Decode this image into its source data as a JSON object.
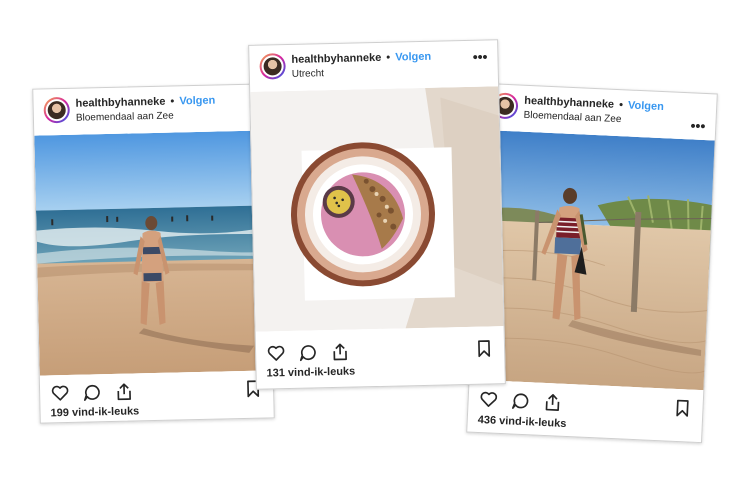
{
  "posts": [
    {
      "username": "healthbyhanneke",
      "separator": "•",
      "follow_label": "Volgen",
      "location": "Bloemendaal aan Zee",
      "likes": "199 vind-ik-leuks",
      "photo": "woman in bikini on beach with sea"
    },
    {
      "username": "healthbyhanneke",
      "separator": "•",
      "follow_label": "Volgen",
      "location": "Utrecht",
      "more_label": "•••",
      "likes": "131 vind-ik-leuks",
      "photo": "smoothie bowl on copper plate"
    },
    {
      "username": "healthbyhanneke",
      "separator": "•",
      "follow_label": "Volgen",
      "location": "Bloemendaal aan Zee",
      "more_label": "•••",
      "likes": "436 vind-ik-leuks",
      "photo": "woman walking in dunes"
    }
  ],
  "icons": [
    "heart-icon",
    "comment-icon",
    "share-icon",
    "bookmark-icon",
    "more-options-icon"
  ],
  "colors": {
    "follow": "#3897f0",
    "text": "#262626",
    "border": "#cfcfcf"
  }
}
